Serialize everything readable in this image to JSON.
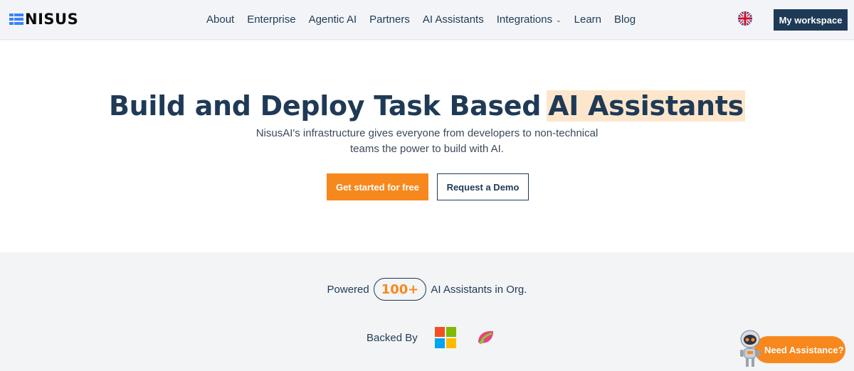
{
  "header": {
    "brand": "NISUS",
    "nav": [
      {
        "label": "About"
      },
      {
        "label": "Enterprise"
      },
      {
        "label": "Agentic AI"
      },
      {
        "label": "Partners"
      },
      {
        "label": "AI Assistants"
      },
      {
        "label": "Integrations",
        "has_dropdown": true
      },
      {
        "label": "Learn"
      },
      {
        "label": "Blog"
      }
    ],
    "language_icon": "uk-flag-icon",
    "workspace_label": "My workspace"
  },
  "hero": {
    "title_main": "Build and Deploy Task Based",
    "title_highlight": "AI Assistants",
    "subtitle": "NisusAI's infrastructure gives everyone from developers to non-technical teams the power to build with AI.",
    "cta_primary": "Get started for free",
    "cta_secondary": "Request a Demo"
  },
  "stats": {
    "prefix": "Powered",
    "count": "100+",
    "suffix": "AI Assistants in Org."
  },
  "backers": {
    "label": "Backed By",
    "logos": [
      "microsoft-logo-icon",
      "leaf-logo-icon"
    ]
  },
  "assistant_widget": {
    "label": "Need Assistance?",
    "icon": "robot-icon"
  },
  "colors": {
    "primary_navy": "#1e3a56",
    "accent_orange": "#f7881d",
    "highlight": "#fde6cc",
    "band_bg": "#f3f4f6"
  }
}
